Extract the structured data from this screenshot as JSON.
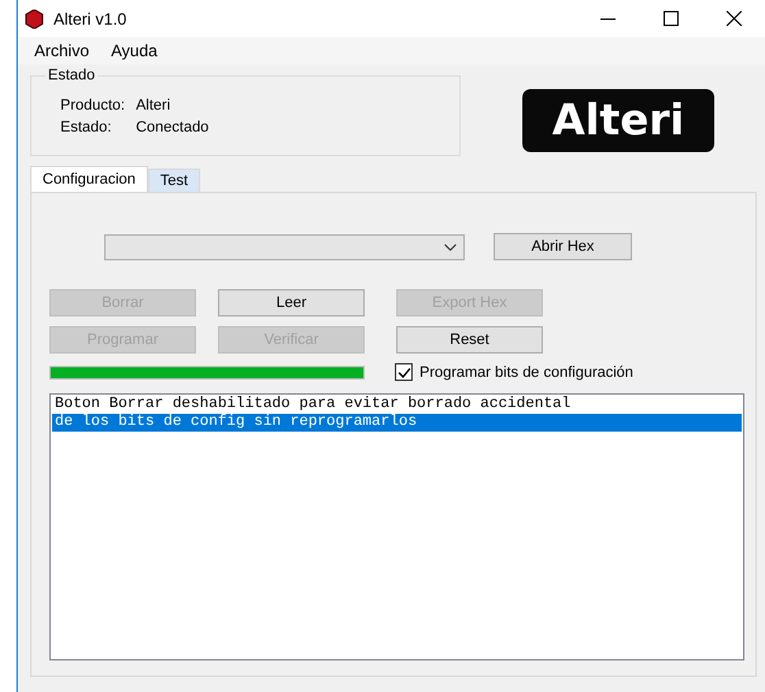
{
  "window": {
    "title": "Alteri v1.0"
  },
  "menu": [
    "Archivo",
    "Ayuda"
  ],
  "status_group": {
    "title": "Estado",
    "rows": [
      {
        "label": "Producto:",
        "value": "Alteri"
      },
      {
        "label": "Estado:",
        "value": "Conectado"
      }
    ]
  },
  "logo": "Alteri",
  "tabs": [
    {
      "label": "Configuracion",
      "selected": true
    },
    {
      "label": "Test",
      "selected": false
    }
  ],
  "open_hex_button": "Abrir Hex",
  "buttons": [
    {
      "label": "Borrar",
      "disabled": true
    },
    {
      "label": "Leer",
      "disabled": false
    },
    {
      "label": "Export Hex",
      "disabled": true
    },
    {
      "label": "Programar",
      "disabled": true
    },
    {
      "label": "Verificar",
      "disabled": true
    },
    {
      "label": "Reset",
      "disabled": false
    }
  ],
  "progress": {
    "level": 1
  },
  "checkbox": {
    "label": "Programar bits de configuración",
    "checked": true
  },
  "log": [
    {
      "text": "Boton Borrar deshabilitado para evitar borrado accidental",
      "selected": false
    },
    {
      "text": "de los bits de config sin reprogramarlos",
      "selected": true
    }
  ]
}
